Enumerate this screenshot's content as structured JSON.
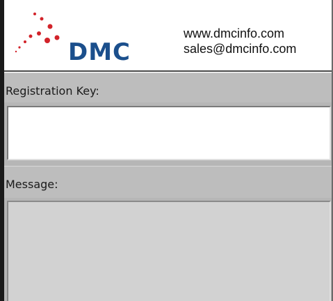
{
  "header": {
    "logo_text": "DMC",
    "website": "www.dmcinfo.com",
    "email": "sales@dmcinfo.com"
  },
  "registration": {
    "label": "Registration Key:",
    "value": ""
  },
  "message": {
    "label": "Message:",
    "value": ""
  },
  "colors": {
    "brand_blue": "#1b4f8c",
    "brand_red": "#d2232a",
    "band_gray": "#bdbdbd",
    "message_bg": "#d2d2d2"
  }
}
